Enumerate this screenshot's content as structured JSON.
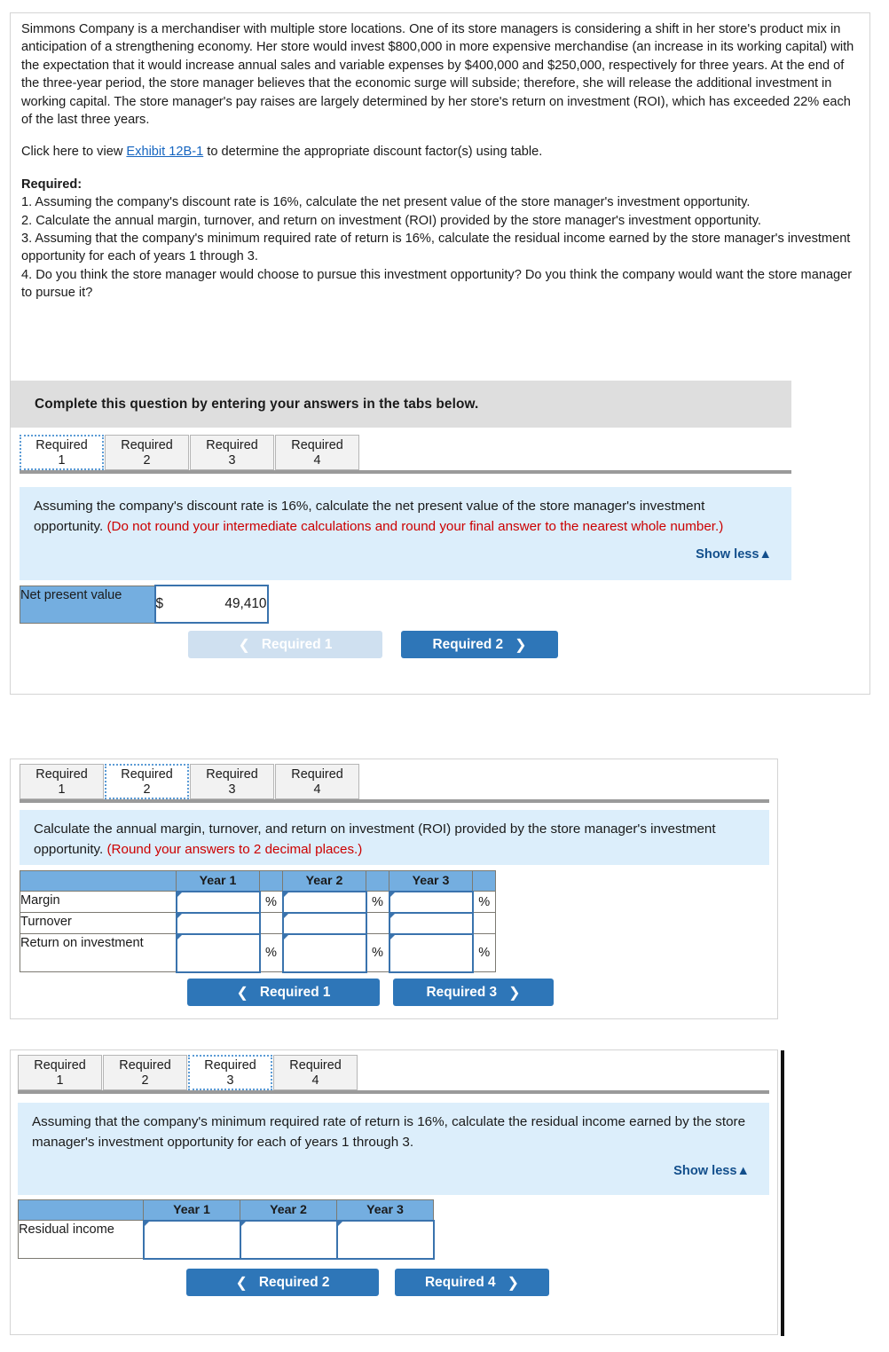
{
  "problem": {
    "paragraph1": "Simmons Company is a merchandiser with multiple store locations. One of its store managers is considering a shift in her store's product mix in anticipation of a strengthening economy. Her store would invest $800,000 in more expensive merchandise (an increase in its working capital) with the expectation that it would increase annual sales and variable expenses by $400,000 and $250,000, respectively for three years. At the end of the three-year period, the store manager believes that the economic surge will subside; therefore, she will release the additional investment in working capital. The store manager's pay raises are largely determined by her store's return on investment (ROI), which has exceeded 22% each of the last three years.",
    "exhibit_prefix": "Click here to view ",
    "exhibit_link": "Exhibit 12B-1",
    "exhibit_suffix": " to determine the appropriate discount factor(s) using table.",
    "required_heading": "Required:",
    "item1": "1. Assuming the company's discount rate is 16%, calculate the net present value of the store manager's investment opportunity.",
    "item2": "2. Calculate the annual margin, turnover, and return on investment (ROI) provided by the store manager's investment opportunity.",
    "item3": "3. Assuming that the company's minimum required rate of return is 16%, calculate the residual income earned by the store manager's investment opportunity for each of years 1 through 3.",
    "item4": "4. Do you think the store manager would choose to pursue this investment opportunity? Do you think the company would want the store manager to pursue it?"
  },
  "banner": {
    "text": "Complete this question by entering your answers in the tabs below."
  },
  "tabs": {
    "labels": [
      "Required",
      "Required",
      "Required",
      "Required"
    ],
    "numbers": [
      "1",
      "2",
      "3",
      "4"
    ],
    "active_panel1": 0,
    "active_panel2": 1,
    "active_panel3": 2
  },
  "panel1": {
    "instruction_black1": "Assuming the company's discount rate is 16%, calculate the net present value of the store manager's investment opportunity. ",
    "instruction_red": "(Do not round your intermediate calculations and round your final answer to the nearest whole number.)",
    "show_less": "Show less▲",
    "row_label": "Net present value",
    "currency_symbol": "$",
    "value": "49,410",
    "prev_button": "Required 1",
    "next_button": "Required 2"
  },
  "panel2": {
    "instruction_black1": "Calculate the annual margin, turnover, and return on investment (ROI) provided by the store manager's investment opportunity. ",
    "instruction_red": "(Round your answers to 2 decimal places.)",
    "column_headers": [
      "",
      "Year 1",
      "",
      "Year 2",
      "",
      "Year 3",
      ""
    ],
    "year_headers": [
      "Year 1",
      "Year 2",
      "Year 3"
    ],
    "rows": [
      {
        "label": "Margin",
        "values": [
          "",
          "",
          ""
        ],
        "suffix": [
          "%",
          "%",
          "%"
        ]
      },
      {
        "label": "Turnover",
        "values": [
          "",
          "",
          ""
        ],
        "suffix": [
          "",
          "",
          ""
        ]
      },
      {
        "label": "Return on investment",
        "values": [
          "",
          "",
          ""
        ],
        "suffix": [
          "%",
          "%",
          "%"
        ]
      }
    ],
    "prev_button": "Required 1",
    "next_button": "Required 3"
  },
  "panel3": {
    "instruction_black1": "Assuming that the company's minimum required rate of return is 16%, calculate the residual income earned by the store manager's investment opportunity for each of years 1 through 3.",
    "show_less": "Show less▲",
    "year_headers": [
      "Year 1",
      "Year 2",
      "Year 3"
    ],
    "rows": [
      {
        "label": "Residual income",
        "values": [
          "",
          "",
          ""
        ]
      }
    ],
    "prev_button": "Required 2",
    "next_button": "Required 4"
  },
  "colors": {
    "accent_blue": "#2e76b8",
    "table_header_blue": "#74aee0",
    "instruction_bg": "#dceefb",
    "red_note": "#cc0000",
    "link_blue": "#1565c0",
    "banner_gray": "#dedede"
  }
}
